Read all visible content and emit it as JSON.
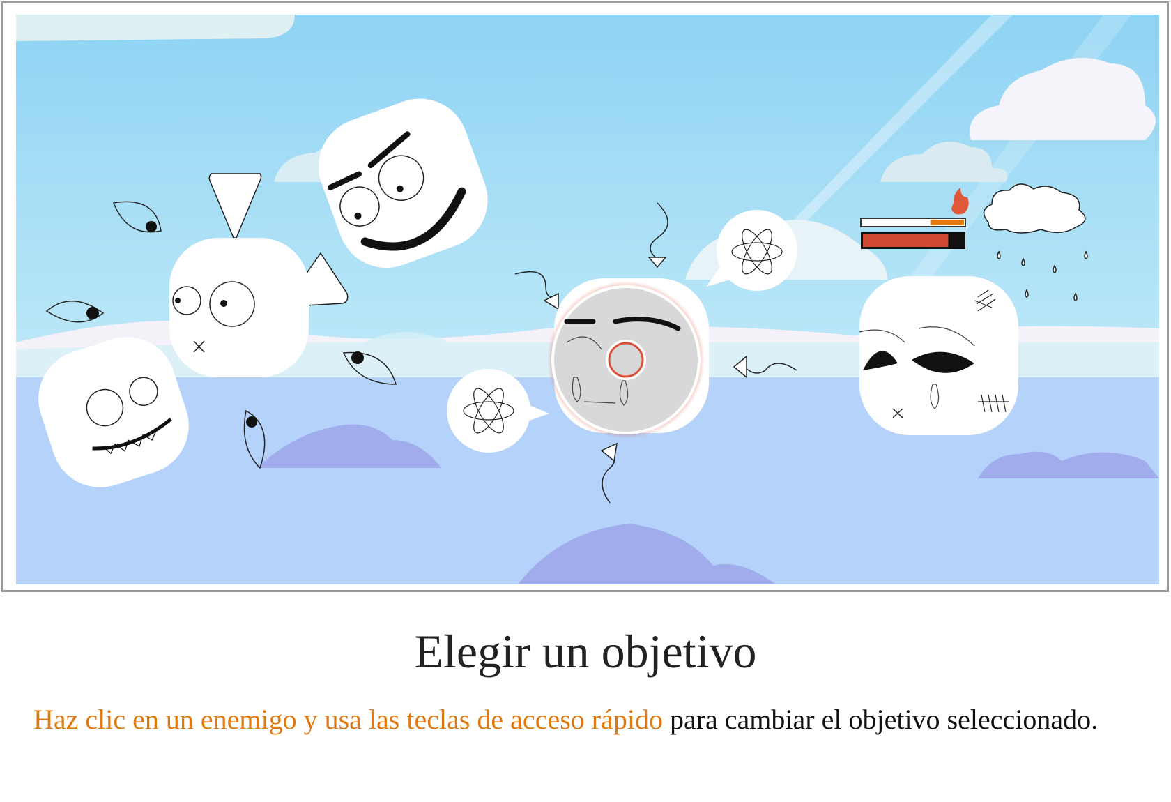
{
  "title": "Elegir un objetivo",
  "description": {
    "highlight": "Haz clic en un enemigo y usa las teclas de acceso rápido",
    "rest": " para cambiar el objetivo seleccionado."
  },
  "colors": {
    "highlight": "#e07a10",
    "sky_top": "#8fd3f4",
    "sky_bottom": "#b9e8f7",
    "ground": "#b5d3fa",
    "hill": "#a0acec",
    "target_ring": "#d9503a",
    "health_bar": "#d04a33",
    "energy_bar": "#e07a10"
  },
  "game": {
    "enemies": [
      {
        "name": "angry-grin-enemy",
        "mood": "angry"
      },
      {
        "name": "horned-enemy",
        "mood": "stunned"
      },
      {
        "name": "toothy-enemy",
        "mood": "grinning"
      },
      {
        "name": "crying-targeted-enemy",
        "mood": "sad",
        "selected": true
      },
      {
        "name": "wounded-sad-enemy",
        "mood": "sad"
      }
    ],
    "status": {
      "energy_fraction": 0.33,
      "health_fraction": 0.85,
      "icons": [
        "fire-icon",
        "rain-cloud-icon",
        "atom-icon"
      ]
    }
  }
}
